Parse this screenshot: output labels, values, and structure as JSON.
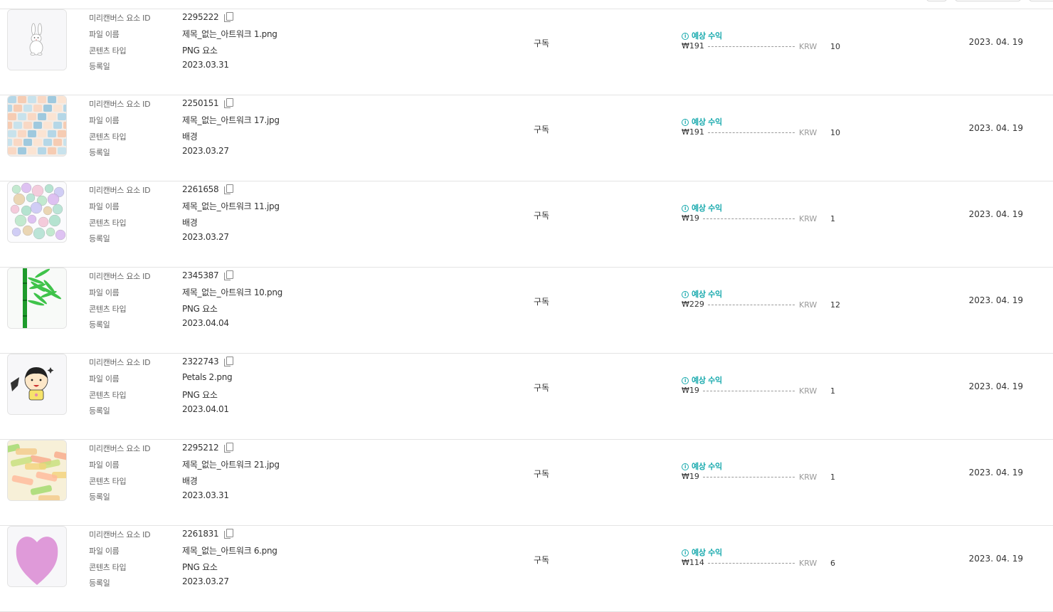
{
  "labels": {
    "element_id": "미리캔버스 요소 ID",
    "file_name": "파일 이름",
    "content_type": "콘텐츠 타입",
    "registered": "등록일",
    "estimated_revenue": "예상 수익",
    "currency": "KRW"
  },
  "icons": {
    "copy": "copy-icon",
    "info": "info-icon"
  },
  "colors": {
    "accent": "#17a9ad",
    "divider": "#e4e4e4"
  },
  "rows": [
    {
      "element_id": "2295222",
      "file_name": "제목_없는_아트워크 1.png",
      "content_type": "PNG 요소",
      "registered": "2023.03.31",
      "license": "구독",
      "revenue": "₩191",
      "count": "10",
      "date": "2023. 04. 19",
      "thumb": "rabbit"
    },
    {
      "element_id": "2250151",
      "file_name": "제목_없는_아트워크 17.jpg",
      "content_type": "배경",
      "registered": "2023.03.27",
      "license": "구독",
      "revenue": "₩191",
      "count": "10",
      "date": "2023. 04. 19",
      "thumb": "pastel-pattern"
    },
    {
      "element_id": "2261658",
      "file_name": "제목_없는_아트워크 11.jpg",
      "content_type": "배경",
      "registered": "2023.03.27",
      "license": "구독",
      "revenue": "₩19",
      "count": "1",
      "date": "2023. 04. 19",
      "thumb": "bubbles"
    },
    {
      "element_id": "2345387",
      "file_name": "제목_없는_아트워크 10.png",
      "content_type": "PNG 요소",
      "registered": "2023.04.04",
      "license": "구독",
      "revenue": "₩229",
      "count": "12",
      "date": "2023. 04. 19",
      "thumb": "bamboo"
    },
    {
      "element_id": "2322743",
      "file_name": "Petals 2.png",
      "content_type": "PNG 요소",
      "registered": "2023.04.01",
      "license": "구독",
      "revenue": "₩19",
      "count": "1",
      "date": "2023. 04. 19",
      "thumb": "girl"
    },
    {
      "element_id": "2295212",
      "file_name": "제목_없는_아트워크 21.jpg",
      "content_type": "배경",
      "registered": "2023.03.31",
      "license": "구독",
      "revenue": "₩19",
      "count": "1",
      "date": "2023. 04. 19",
      "thumb": "brush-pattern"
    },
    {
      "element_id": "2261831",
      "file_name": "제목_없는_아트워크 6.png",
      "content_type": "PNG 요소",
      "registered": "2023.03.27",
      "license": "구독",
      "revenue": "₩114",
      "count": "6",
      "date": "2023. 04. 19",
      "thumb": "heart"
    }
  ]
}
